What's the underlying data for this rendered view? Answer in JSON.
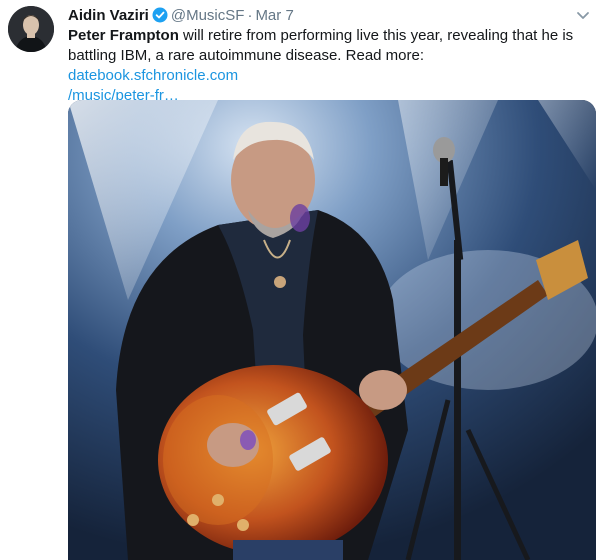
{
  "tweet": {
    "author_name": "Aidin Vaziri",
    "handle": "@MusicSF",
    "separator": "·",
    "date": "Mar 7",
    "text_bold": "Peter Frampton",
    "text_main": " will retire from performing live this year, revealing that he is battling IBM, a rare autoimmune disease. Read more: ",
    "link_line1": "datebook.sfchronicle.com",
    "link_line2": "/music/peter-fr…"
  },
  "icons": {
    "verified": "verified-badge-icon",
    "caret": "chevron-down-icon",
    "avatar": "avatar"
  },
  "colors": {
    "link": "#1b95e0",
    "meta": "#657786",
    "verified": "#1da1f2",
    "text": "#14171a"
  }
}
